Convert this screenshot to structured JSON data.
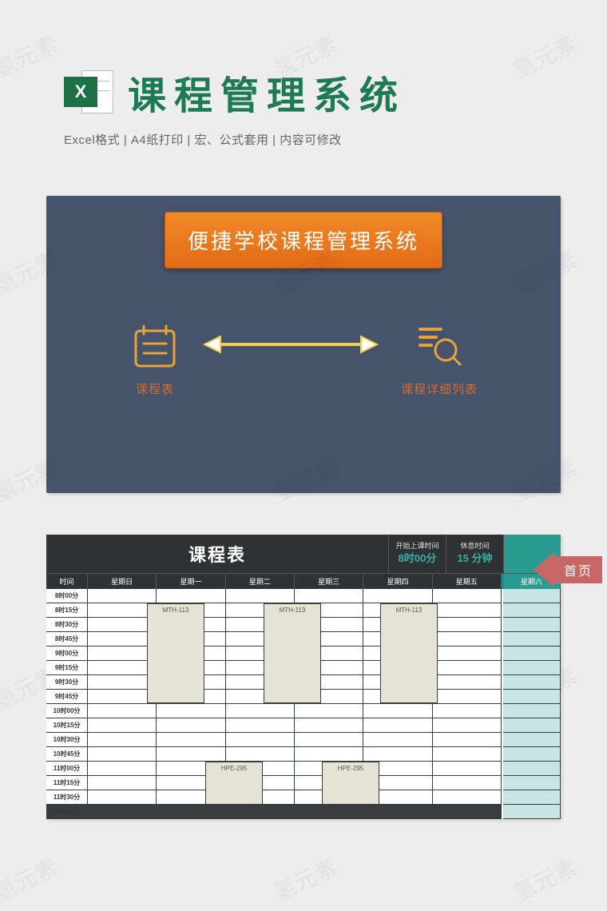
{
  "watermark_text": "氢元素",
  "header": {
    "excel_letter": "X",
    "title": "课程管理系统",
    "subtitle": "Excel格式 |  A4纸打印 | 宏、公式套用 | 内容可修改"
  },
  "panel1": {
    "banner": "便捷学校课程管理系统",
    "left_caption": "课程表",
    "right_caption": "课程详细列表"
  },
  "schedule": {
    "title": "课程表",
    "start_label": "开始上课时间",
    "start_value": "8时00分",
    "break_label": "休息时间",
    "break_value": "15 分钟",
    "home_label": "首页",
    "headers": {
      "time": "时间",
      "sun": "星期日",
      "mon": "星期一",
      "tue": "星期二",
      "wed": "星期三",
      "thu": "星期四",
      "fri": "星期五",
      "sat": "星期六"
    },
    "time_slots": [
      "8时00分",
      "8时15分",
      "8时30分",
      "8时45分",
      "9时00分",
      "9时15分",
      "9时30分",
      "9时45分",
      "10时00分",
      "10时15分",
      "10时30分",
      "10时45分",
      "11时00分",
      "11时15分",
      "11时30分",
      "11时45分"
    ],
    "courses": {
      "mth": "MTH-113",
      "hpe": "HPE-295"
    }
  }
}
